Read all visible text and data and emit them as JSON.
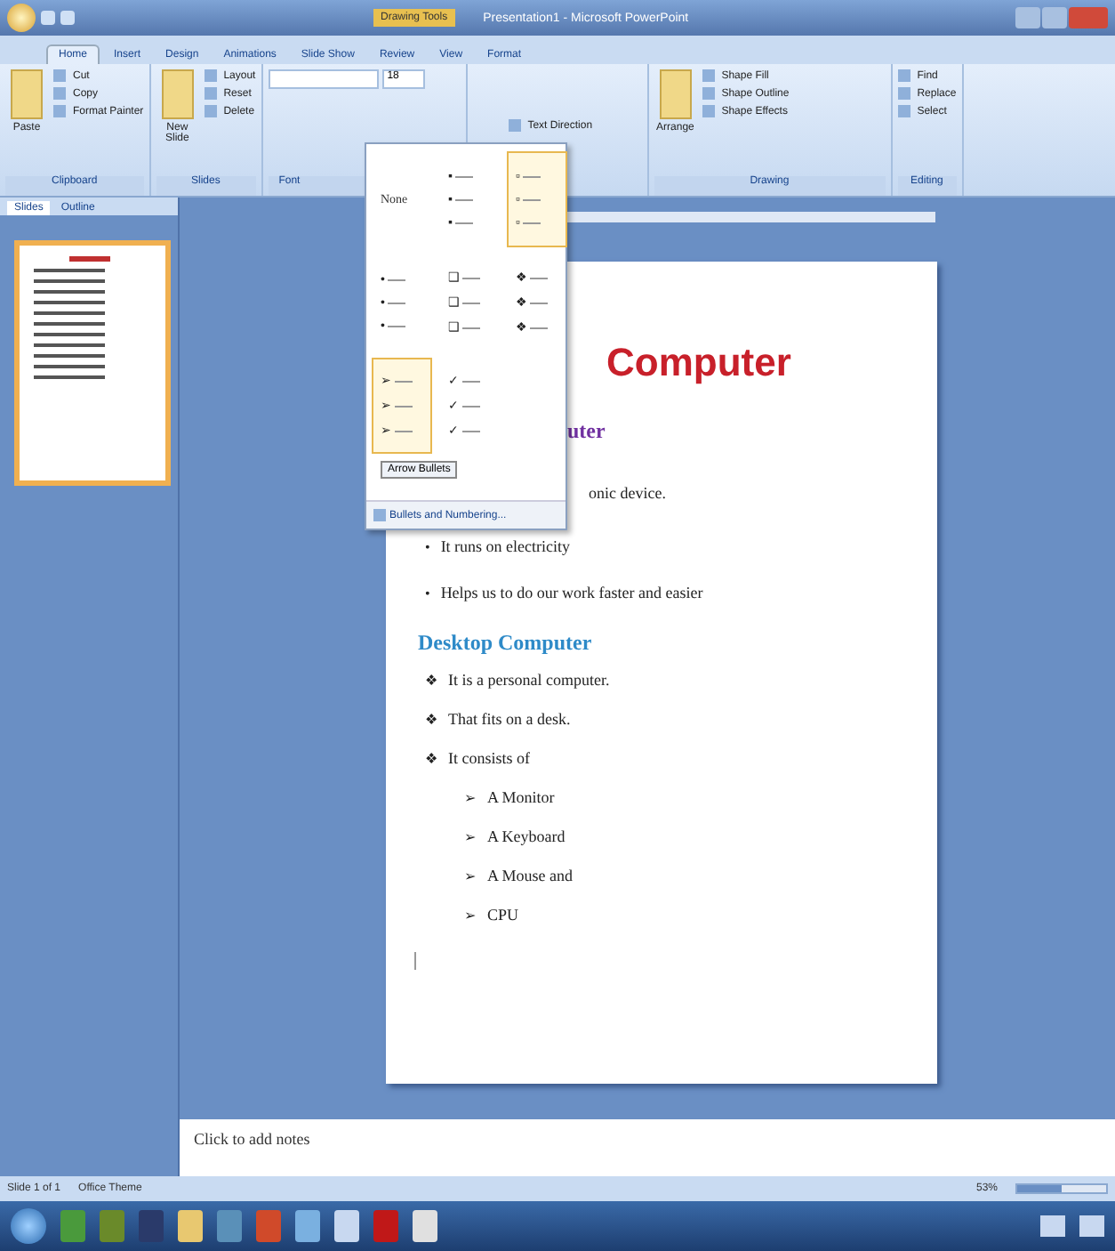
{
  "window": {
    "title": "Presentation1 - Microsoft PowerPoint",
    "context_tab": "Drawing Tools"
  },
  "ribbon_tabs": [
    {
      "label": "Home",
      "selected": true
    },
    {
      "label": "Insert",
      "selected": false
    },
    {
      "label": "Design",
      "selected": false
    },
    {
      "label": "Animations",
      "selected": false
    },
    {
      "label": "Slide Show",
      "selected": false
    },
    {
      "label": "Review",
      "selected": false
    },
    {
      "label": "View",
      "selected": false
    },
    {
      "label": "Format",
      "selected": false
    }
  ],
  "ribbon_groups": [
    {
      "name": "Clipboard",
      "buttons": [
        "Cut",
        "Copy",
        "Format Painter"
      ],
      "big": "Paste"
    },
    {
      "name": "Slides",
      "buttons": [
        "Layout",
        "Reset",
        "Delete"
      ],
      "big": "New Slide"
    },
    {
      "name": "Font",
      "font_size": "18"
    },
    {
      "buttons": [
        "Text Direction"
      ]
    },
    {
      "name": "Drawing",
      "buttons": [
        "Shape Fill",
        "Shape Outline",
        "Shape Effects"
      ],
      "big": "Arrange"
    },
    {
      "name": "Editing",
      "buttons": [
        "Find",
        "Replace",
        "Select"
      ]
    }
  ],
  "bullet_menu": {
    "none_label": "None",
    "cells": [
      {
        "kind": "none",
        "selected": false
      },
      {
        "kind": "bullet",
        "glyph": "▪",
        "selected": false
      },
      {
        "kind": "bullet",
        "glyph": "▫",
        "selected": true
      },
      {
        "kind": "bullet",
        "glyph": "•",
        "selected": false
      },
      {
        "kind": "bullet",
        "glyph": "❑",
        "selected": false
      },
      {
        "kind": "bullet",
        "glyph": "❖",
        "selected": false
      },
      {
        "kind": "bullet",
        "glyph": "➢",
        "selected": true
      },
      {
        "kind": "bullet",
        "glyph": "✓",
        "selected": false
      }
    ],
    "tooltip": "Arrow Bullets",
    "footer": "Bullets and Numbering..."
  },
  "left_pane": {
    "tabs": [
      {
        "label": "Slides",
        "selected": true
      },
      {
        "label": "Outline",
        "selected": false
      }
    ]
  },
  "slide": {
    "title": "Computer",
    "heading_1": "uter",
    "line_1": "onic device.",
    "bullets_1": [
      {
        "mark": "•",
        "text": "It runs on electricity"
      },
      {
        "mark": "•",
        "text": "Helps us to do our work faster and easier"
      }
    ],
    "heading_2": "Desktop Computer",
    "bullets_2": [
      {
        "mark": "❖",
        "text": "It is a personal computer."
      },
      {
        "mark": "❖",
        "text": "That fits on a desk."
      },
      {
        "mark": "❖",
        "text": "It consists of"
      }
    ],
    "sub_bullets": [
      {
        "mark": "➢",
        "text": "A Monitor"
      },
      {
        "mark": "➢",
        "text": "A Keyboard"
      },
      {
        "mark": "➢",
        "text": "A Mouse and"
      },
      {
        "mark": "➢",
        "text": "CPU"
      }
    ]
  },
  "notes": {
    "placeholder": "Click to add notes"
  },
  "status_bar": {
    "slide": "Slide 1 of 1",
    "theme": "Office Theme",
    "zoom": "53%",
    "zoom_slider": {
      "level": 0.5
    }
  }
}
